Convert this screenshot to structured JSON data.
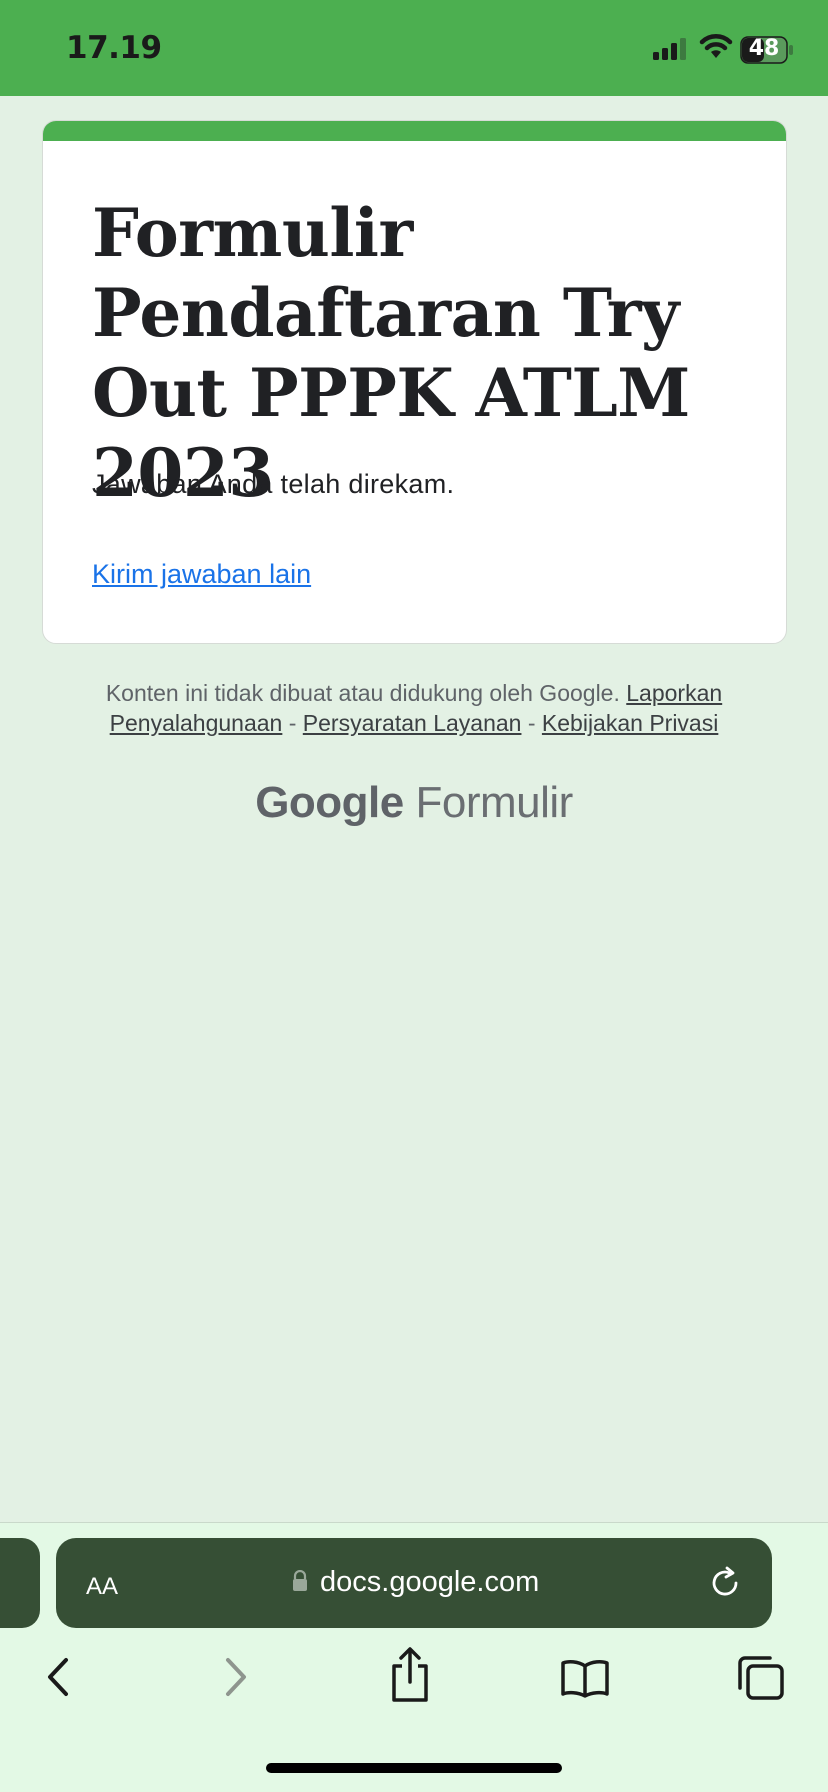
{
  "status_bar": {
    "time": "17.19",
    "battery": "48"
  },
  "form": {
    "title": "Formulir Pendaftaran Try Out PPPK ATLM 2023",
    "confirmation": "Jawaban Anda telah direkam.",
    "submit_another": "Kirim jawaban lain",
    "accent_color": "#4caf50"
  },
  "footer": {
    "disclaimer": "Konten ini tidak dibuat atau didukung oleh Google.",
    "report_abuse": "Laporkan Penyalahgunaan",
    "separator": "-",
    "terms": "Persyaratan Layanan",
    "privacy": "Kebijakan Privasi",
    "brand_google": "Google",
    "brand_product": "Formulir"
  },
  "browser": {
    "text_size_label": "AA",
    "url": "docs.google.com",
    "toolbar_icons": [
      "back-icon",
      "forward-icon",
      "share-icon",
      "bookmarks-icon",
      "tabs-icon"
    ]
  }
}
